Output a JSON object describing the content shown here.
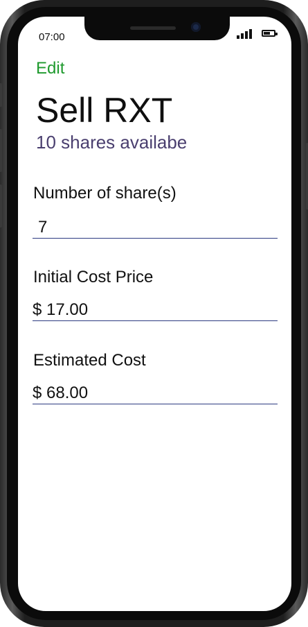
{
  "status_bar": {
    "time": "07:00"
  },
  "header": {
    "edit_label": "Edit",
    "title": "Sell RXT",
    "subtitle": "10 shares availabe"
  },
  "form": {
    "shares": {
      "label": "Number of share(s)",
      "value": "7"
    },
    "initial_cost": {
      "label": "Initial Cost Price",
      "value": "$ 17.00"
    },
    "estimated_cost": {
      "label": "Estimated Cost",
      "value": "$ 68.00"
    }
  },
  "colors": {
    "edit_green": "#1f9a2e",
    "subtitle_purple": "#4a3f6f",
    "underline_blue": "#2c3a80"
  }
}
